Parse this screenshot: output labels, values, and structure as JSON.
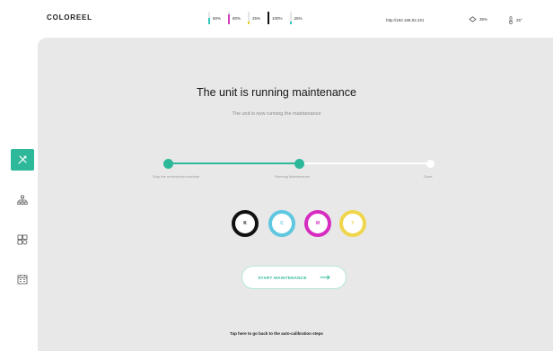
{
  "app": {
    "brand": "COLOREEL"
  },
  "header": {
    "inks": [
      {
        "value": "50%",
        "level": 0.5,
        "color": "#2fc7c0"
      },
      {
        "value": "80%",
        "level": 0.8,
        "color": "#d23fbf"
      },
      {
        "value": "25%",
        "level": 0.25,
        "color": "#e9cf2c"
      },
      {
        "value": "100%",
        "level": 1.0,
        "color": "#111111"
      },
      {
        "value": "25%",
        "level": 0.25,
        "color": "#2fc7c0"
      }
    ],
    "url": "http://192.168.02.221",
    "humidity": "35%",
    "temperature": "25°"
  },
  "sidebar": {
    "items": [
      {
        "icon": "tools-icon",
        "active": true
      },
      {
        "icon": "network-icon",
        "active": false
      },
      {
        "icon": "modules-icon",
        "active": false
      },
      {
        "icon": "calendar-icon",
        "active": false
      }
    ]
  },
  "main": {
    "title": "The unit is running maintenance",
    "subtitle": "The unit is now running the maintenance",
    "steps": [
      {
        "label": "Stop the embroidery machine",
        "status": "done"
      },
      {
        "label": "Running Maintenance",
        "status": "done"
      },
      {
        "label": "Done",
        "status": "pending"
      }
    ],
    "cartridges": [
      {
        "label": "K",
        "color": "#111111"
      },
      {
        "label": "C",
        "color": "#5fc7df"
      },
      {
        "label": "M",
        "color": "#d62cc0"
      },
      {
        "label": "Y",
        "color": "#f0d64c"
      }
    ],
    "start_label": "START MAINTENANCE",
    "back_link": "Tap here to go back to the auto-calibration steps"
  },
  "colors": {
    "accent": "#2db89a",
    "panel": "#e8e8e8"
  }
}
